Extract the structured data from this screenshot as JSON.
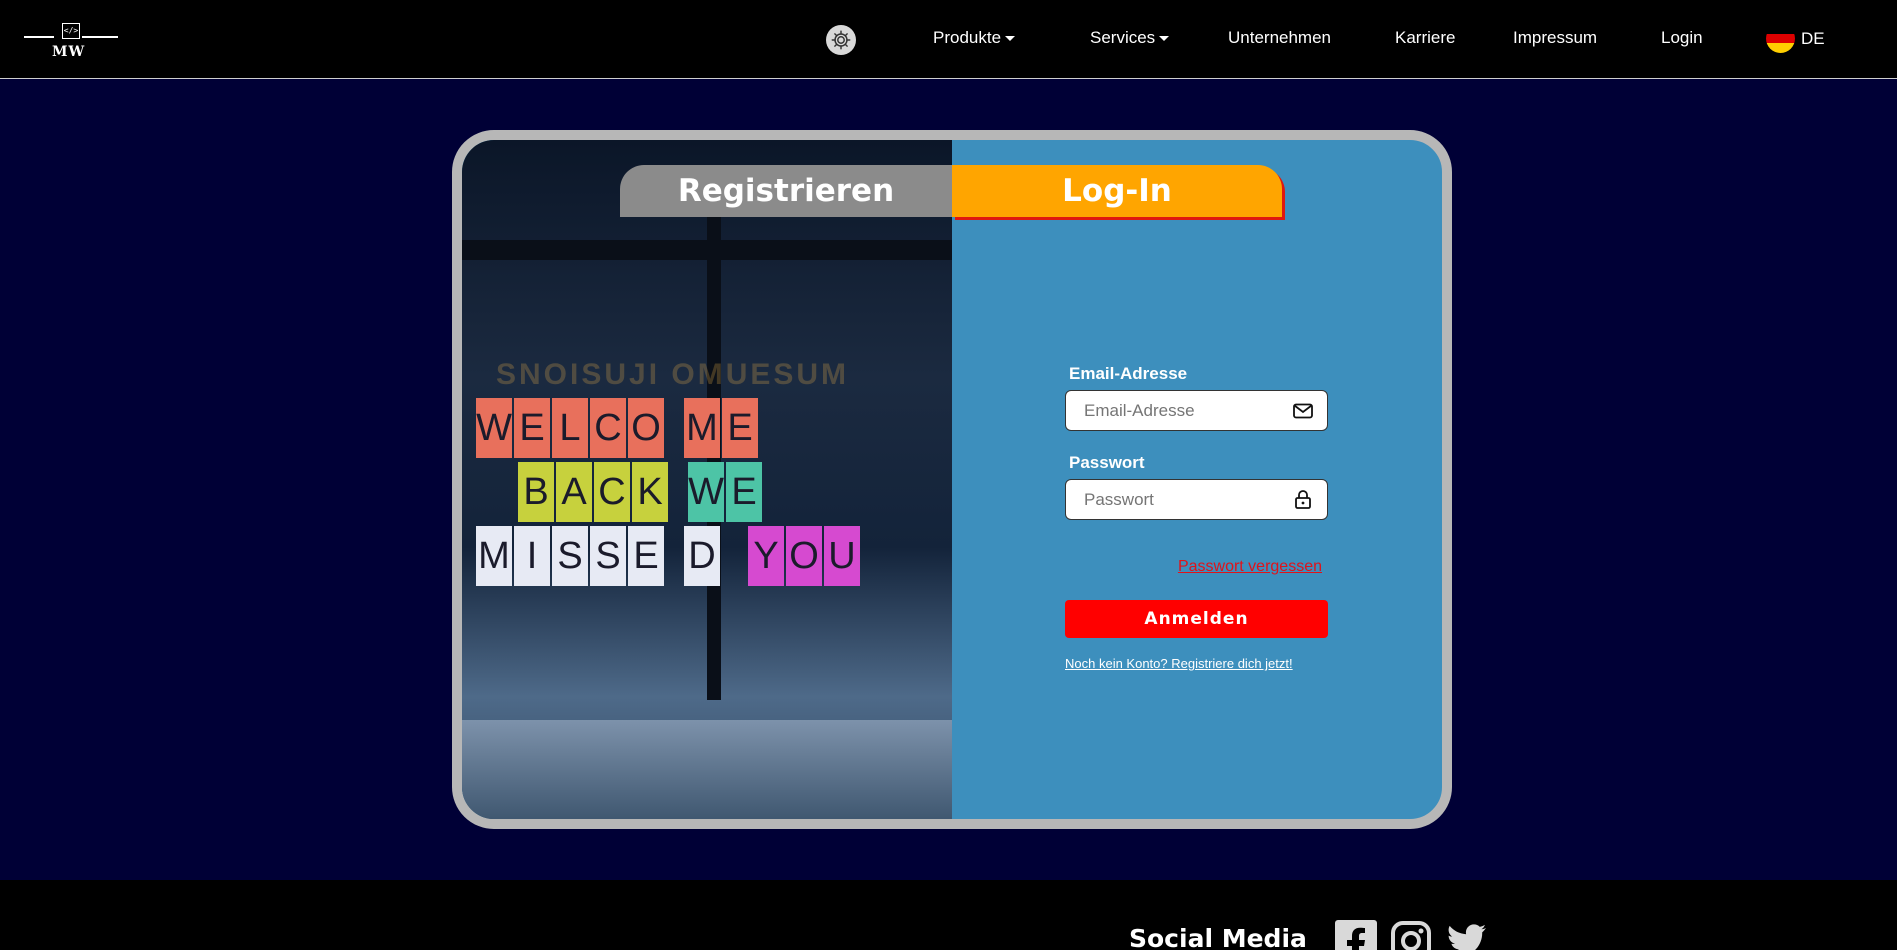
{
  "header": {
    "logo_text": "MW",
    "logo_code": "</>",
    "nav": [
      {
        "label": "Produkte"
      },
      {
        "label": "Services"
      },
      {
        "label": "Unternehmen"
      },
      {
        "label": "Karriere"
      },
      {
        "label": "Impressum"
      },
      {
        "label": "Login"
      }
    ],
    "language": "DE"
  },
  "card": {
    "tabs": {
      "register": "Registrieren",
      "login": "Log-In"
    },
    "photo_sign": {
      "row1": [
        "W",
        "E",
        "L",
        "C",
        "O",
        "M",
        "E"
      ],
      "row2": [
        "B",
        "A",
        "C",
        "K",
        "W",
        "E"
      ],
      "row3": [
        "M",
        "I",
        "S",
        "S",
        "E",
        "D",
        "Y",
        "O",
        "U"
      ],
      "reflection": "SNOISUJI  OMUESUM"
    },
    "form": {
      "email_label": "Email-Adresse",
      "email_placeholder": "Email-Adresse",
      "password_label": "Passwort",
      "password_placeholder": "Passwort",
      "forgot": "Passwort vergessen",
      "submit": "Anmelden",
      "register_prompt": "Noch kein Konto? Registriere dich jetzt!"
    }
  },
  "footer": {
    "social_title": "Social Media"
  },
  "icons": {
    "settings": "gear-icon",
    "email": "envelope-icon",
    "password": "lock-icon",
    "social": [
      "facebook-icon",
      "instagram-icon",
      "twitter-icon"
    ]
  },
  "colors": {
    "background": "#000036",
    "card_panel": "#3d8fbd",
    "login_tab": "#ffa500",
    "register_tab": "#8b8b8b",
    "submit": "#ff0000",
    "forgot_link": "#e0131a"
  }
}
